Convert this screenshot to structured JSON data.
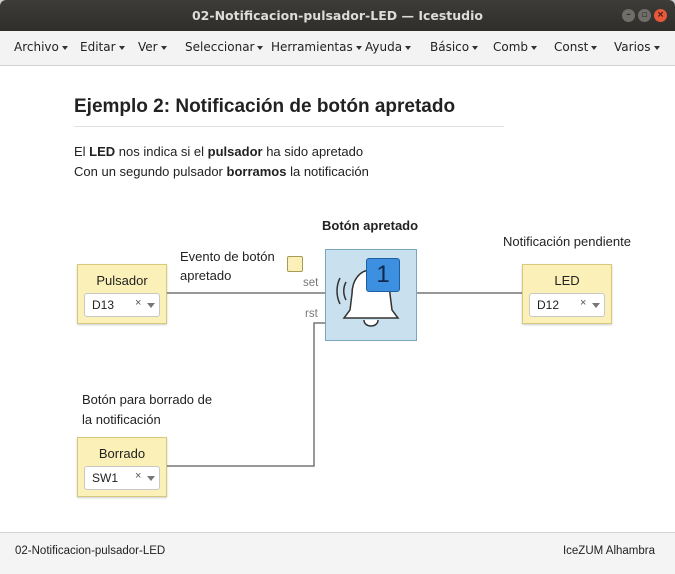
{
  "window": {
    "title": "02-Notificacion-pulsador-LED — Icestudio"
  },
  "menu": [
    {
      "label": "Archivo"
    },
    {
      "label": "Editar"
    },
    {
      "label": "Ver"
    },
    {
      "label": "Seleccionar"
    },
    {
      "label": "Herramientas"
    },
    {
      "label": "Ayuda"
    },
    {
      "label": "Básico"
    },
    {
      "label": "Comb"
    },
    {
      "label": "Const"
    },
    {
      "label": "Varios"
    }
  ],
  "doc": {
    "heading": "Ejemplo 2: Notificación de botón apretado",
    "line1": {
      "a": "El ",
      "b": "LED",
      "c": " nos indica si el ",
      "d": "pulsador",
      "e": " ha sido apretado"
    },
    "line2": {
      "a": "Con un segundo pulsador ",
      "b": "borramos",
      "c": " la notificación"
    }
  },
  "labels": {
    "block_title": "Botón apretado",
    "event": "Evento de botón",
    "event2": "apretado",
    "notif": "Notificación pendiente",
    "clear1": "Botón para borrado de",
    "clear2": "la notificación"
  },
  "inputs": {
    "pulsador": {
      "name": "Pulsador",
      "value": "D13"
    },
    "borrado": {
      "name": "Borrado",
      "value": "SW1"
    },
    "led": {
      "name": "LED",
      "value": "D12"
    }
  },
  "block": {
    "badge": "1",
    "port_set": "set",
    "port_rst": "rst",
    "icon": "bell-icon"
  },
  "status": {
    "left": "02-Notificacion-pulsador-LED",
    "right": "IceZUM Alhambra"
  },
  "clear_symbol": "×"
}
